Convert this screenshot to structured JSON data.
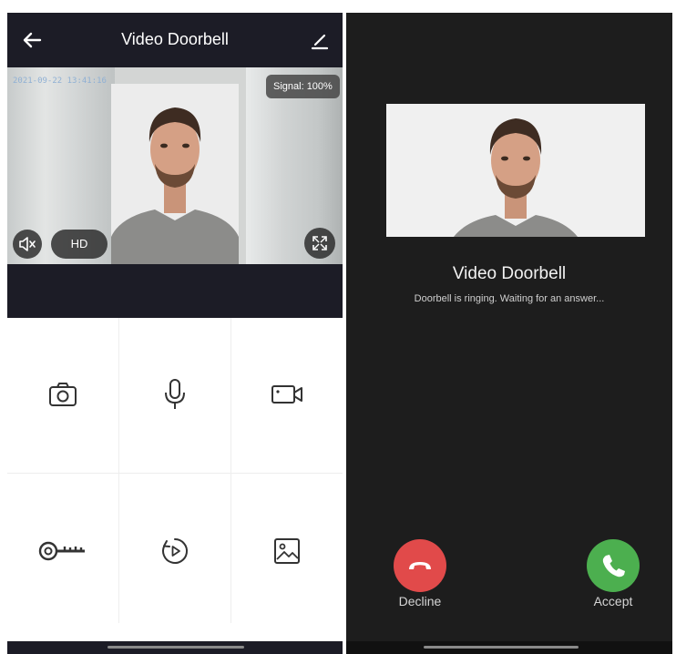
{
  "doorbell_screen": {
    "title": "Video Doorbell",
    "timestamp": "2021-09-22 13:41:16",
    "signal": "Signal: 100%",
    "hd_label": "HD",
    "icons": {
      "back": "arrow-left-icon",
      "edit": "pencil-icon",
      "mute": "speaker-muted-icon",
      "fullscreen": "fullscreen-icon"
    },
    "controls": [
      {
        "name": "camera-snapshot",
        "icon": "camera-icon"
      },
      {
        "name": "microphone",
        "icon": "microphone-icon"
      },
      {
        "name": "video-record",
        "icon": "video-camera-icon"
      },
      {
        "name": "unlock",
        "icon": "key-icon"
      },
      {
        "name": "playback",
        "icon": "playback-icon"
      },
      {
        "name": "gallery",
        "icon": "image-icon"
      }
    ]
  },
  "incoming_call": {
    "title": "Video Doorbell",
    "subtitle": "Doorbell is ringing. Waiting for an answer...",
    "decline_label": "Decline",
    "accept_label": "Accept"
  },
  "colors": {
    "header_bg": "#1c1c26",
    "call_bg": "#1d1d1d",
    "decline": "#e14a4a",
    "accept": "#4caf4f"
  }
}
